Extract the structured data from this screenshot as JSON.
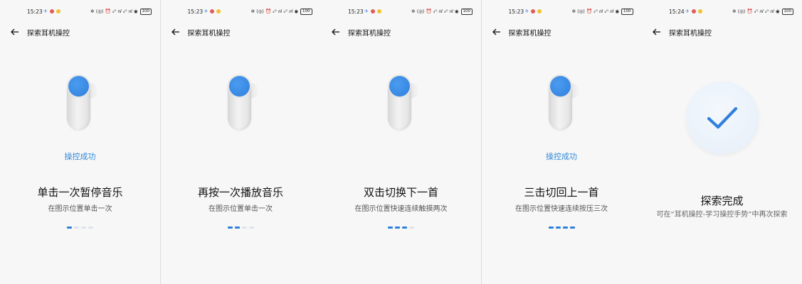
{
  "colors": {
    "accent": "#2f80dd",
    "success_text": "#2f88d8"
  },
  "screens": [
    {
      "status": {
        "time": "15:23",
        "right": "✲ ⟨◎⟩ ⏰ ₄ᴳ 𝑛𝑙 ₄ᴳ 𝑛𝑙 ◉",
        "battery": "100"
      },
      "header": {
        "title": "探索耳机操控"
      },
      "success": "操控成功",
      "main": "单击一次暂停音乐",
      "sub": "在图示位置单击一次",
      "progress": {
        "active": 1,
        "total": 4
      }
    },
    {
      "status": {
        "time": "15:23",
        "right": "✲ ⟨◎⟩ ⏰ ₄ᴳ 𝑛𝑙 ₄ᴳ 𝑛𝑙 ◉",
        "battery": "100"
      },
      "header": {
        "title": "探索耳机操控"
      },
      "success": "",
      "main": "再按一次播放音乐",
      "sub": "在图示位置单击一次",
      "progress": {
        "active": 2,
        "total": 4
      }
    },
    {
      "status": {
        "time": "15:23",
        "right": "✲ ⟨◎⟩ ⏰ ₄ᴳ 𝑛𝑙 ₄ᴳ 𝑛𝑙 ◉",
        "battery": "100"
      },
      "header": {
        "title": "探索耳机操控"
      },
      "success": "",
      "main": "双击切换下一首",
      "sub": "在图示位置快速连续触摸两次",
      "progress": {
        "active": 3,
        "total": 4
      }
    },
    {
      "status": {
        "time": "15:23",
        "right": "✲ ⟨◎⟩ ⏰ ₄ᴳ 𝑛𝑙 ₄ᴳ 𝑛𝑙 ◉",
        "battery": "100"
      },
      "header": {
        "title": "探索耳机操控"
      },
      "success": "操控成功",
      "main": "三击切回上一首",
      "sub": "在图示位置快速连续按压三次",
      "progress": {
        "active": 4,
        "total": 4
      }
    },
    {
      "status": {
        "time": "15:24",
        "right": "✲ ⟨◎⟩ ⏰ ₄ᴳ 𝑛𝑙 ₄ᴳ 𝑛𝑙 ◉",
        "battery": "100"
      },
      "header": {
        "title": "探索耳机操控"
      },
      "done_title": "探索完成",
      "done_sub": "可在“耳机操控-学习操控手势”中再次探索"
    }
  ]
}
